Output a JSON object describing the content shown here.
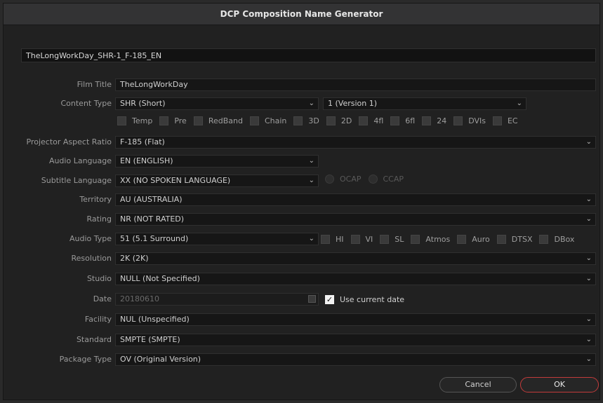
{
  "dialog": {
    "title": "DCP Composition Name Generator",
    "composition_name": "TheLongWorkDay_SHR-1_F-185_EN"
  },
  "form": {
    "film_title": {
      "label": "Film Title",
      "value": "TheLongWorkDay"
    },
    "content_type": {
      "label": "Content Type",
      "value": "SHR (Short)",
      "version": "1 (Version 1)"
    },
    "content_flags": [
      "Temp",
      "Pre",
      "RedBand",
      "Chain",
      "3D",
      "2D",
      "4fl",
      "6fl",
      "24",
      "DVIs",
      "EC"
    ],
    "projector_aspect_ratio": {
      "label": "Projector Aspect Ratio",
      "value": "F-185 (Flat)"
    },
    "audio_language": {
      "label": "Audio Language",
      "value": "EN (ENGLISH)"
    },
    "subtitle_language": {
      "label": "Subtitle Language",
      "value": "XX (NO SPOKEN LANGUAGE)",
      "options": [
        "OCAP",
        "CCAP"
      ]
    },
    "territory": {
      "label": "Territory",
      "value": "AU (AUSTRALIA)"
    },
    "rating": {
      "label": "Rating",
      "value": "NR (NOT RATED)"
    },
    "audio_type": {
      "label": "Audio Type",
      "value": "51 (5.1 Surround)",
      "flags": [
        "HI",
        "VI",
        "SL",
        "Atmos",
        "Auro",
        "DTSX",
        "DBox"
      ]
    },
    "resolution": {
      "label": "Resolution",
      "value": "2K (2K)"
    },
    "studio": {
      "label": "Studio",
      "value": "NULL (Not Specified)"
    },
    "date": {
      "label": "Date",
      "value": "20180610",
      "use_current_label": "Use current date",
      "use_current": true
    },
    "facility": {
      "label": "Facility",
      "value": "NUL (Unspecified)"
    },
    "standard": {
      "label": "Standard",
      "value": "SMPTE (SMPTE)"
    },
    "package_type": {
      "label": "Package Type",
      "value": "OV (Original Version)"
    }
  },
  "buttons": {
    "cancel": "Cancel",
    "ok": "OK"
  },
  "colors": {
    "accent_ok_border": "#c23b3b",
    "background": "#212121"
  },
  "icons": {
    "dropdown": "chevron-down-icon",
    "calendar": "calendar-icon",
    "checkmark": "check-icon"
  }
}
